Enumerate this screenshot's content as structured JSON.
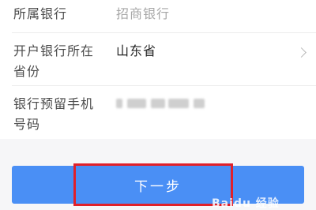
{
  "form": {
    "bank": {
      "label": "所属银行",
      "value": "招商银行"
    },
    "province": {
      "label_line1": "开户银行所在",
      "label_line2": "省份",
      "value": "山东省"
    },
    "phone": {
      "label_line1": "银行预留手机",
      "label_line2": "号码",
      "value_masked": true
    }
  },
  "actions": {
    "next_label": "下一步"
  },
  "watermark": {
    "text": "Baidu 经验"
  },
  "colors": {
    "button": "#4a8ff5",
    "highlight": "#e0202a",
    "background": "#f6f6f8"
  },
  "icons": {
    "province_chevron": "chevron-right-icon"
  }
}
